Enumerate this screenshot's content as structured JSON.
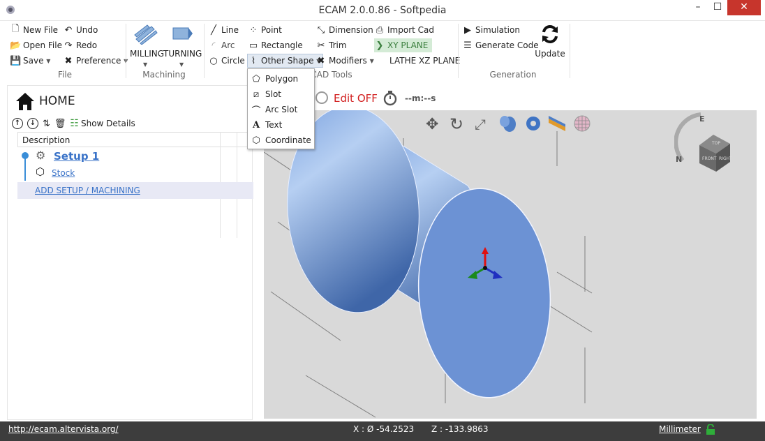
{
  "window": {
    "title": "ECAM 2.0.0.86 - Softpedia",
    "min": "–",
    "max": "☐",
    "close": "✕"
  },
  "ribbon": {
    "file": {
      "label": "File",
      "new_file": "New File",
      "open_file": "Open File",
      "save": "Save",
      "undo": "Undo",
      "redo": "Redo",
      "preference": "Preference"
    },
    "machining": {
      "label": "Machining",
      "milling": "MILLING",
      "turning": "TURNING"
    },
    "shapes": {
      "line": "Line",
      "arc": "Arc",
      "circle": "Circle",
      "point": "Point",
      "rectangle": "Rectangle",
      "other_shape": "Other Shape"
    },
    "cad_tools": {
      "label": "CAD Tools",
      "dimension": "Dimension",
      "trim": "Trim",
      "modifiers": "Modifiers",
      "import_cad": "Import Cad",
      "xy_plane": "XY PLANE",
      "lathe_xz_plane": "LATHE XZ PLANE"
    },
    "generation": {
      "label": "Generation",
      "simulation": "Simulation",
      "generate_code": "Generate Code",
      "update": "Update"
    }
  },
  "other_shape_menu": [
    "Polygon",
    "Slot",
    "Arc Slot",
    "Text",
    "Coordinate"
  ],
  "left": {
    "home": "HOME",
    "show_details": "Show Details",
    "column_header": "Description",
    "setup": "Setup 1",
    "stock": "Stock",
    "add_setup": "ADD SETUP / MACHINING"
  },
  "view_toolbar": {
    "edit": "Edit OFF",
    "timer": "--m:--s"
  },
  "viewcube": {
    "compass_n": "N",
    "compass_e": "E",
    "face_top": "TOP",
    "face_front": "FRONT",
    "face_right": "RIGHT"
  },
  "status": {
    "url": "http://ecam.altervista.org/",
    "x": "X : Ø -54.2523",
    "z": "Z : -133.9863",
    "units": "Millimeter"
  },
  "colors": {
    "accent": "#3a73c8",
    "edit_off": "#d22020",
    "xy_plane": "#3b7f3e",
    "cylinder": "#6e96d8",
    "status_bg": "#3d3d3d",
    "lock": "#2fae3a"
  }
}
